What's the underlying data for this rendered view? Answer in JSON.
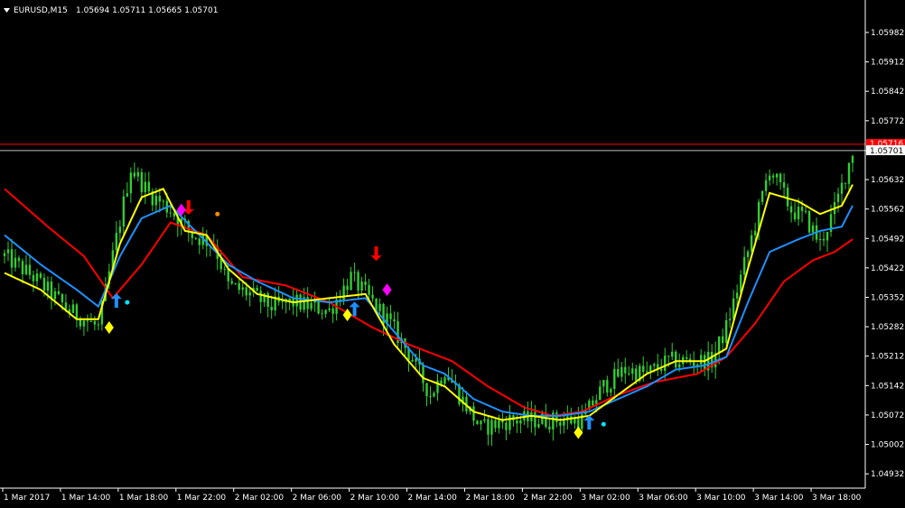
{
  "header": {
    "symbol": "EURUSD,M15",
    "ohlc": "1.05694 1.05711 1.05665 1.05701",
    "menu_icon": "triangle-down-icon"
  },
  "colors": {
    "background": "#000000",
    "axis": "#ffffff",
    "candles": "#32cd32",
    "ma_red": "#ff0000",
    "ma_yellow": "#ffff00",
    "ma_blue": "#1e90ff",
    "hline_red": "#ff0000",
    "hline_bid": "#c0c0c0",
    "marker_up": "#1e90ff",
    "marker_down": "#ff0000",
    "diamond_yellow": "#ffff00",
    "diamond_magenta": "#ff00ff",
    "dot_cyan": "#00e5ff",
    "dot_orange": "#ff8c00"
  },
  "chart_data": {
    "type": "candlestick",
    "title": "EURUSD,M15",
    "ylim": [
      1.04898,
      1.06012
    ],
    "y_ticks": [
      "1.05982",
      "1.05912",
      "1.05842",
      "1.05772",
      "1.05701",
      "1.05632",
      "1.05562",
      "1.05492",
      "1.05422",
      "1.05352",
      "1.05282",
      "1.05212",
      "1.05142",
      "1.05072",
      "1.05002",
      "1.04932"
    ],
    "current_price_label": "1.05701",
    "red_line_label": "1.05716",
    "red_line_price": 1.05716,
    "x_ticks": [
      "1 Mar 2017",
      "1 Mar 14:00",
      "1 Mar 18:00",
      "1 Mar 22:00",
      "2 Mar 02:00",
      "2 Mar 06:00",
      "2 Mar 10:00",
      "2 Mar 14:00",
      "2 Mar 18:00",
      "2 Mar 22:00",
      "3 Mar 02:00",
      "3 Mar 06:00",
      "3 Mar 10:00",
      "3 Mar 14:00",
      "3 Mar 18:00"
    ],
    "x_tick_index": [
      0,
      16,
      32,
      48,
      64,
      80,
      96,
      112,
      128,
      144,
      160,
      176,
      192,
      208,
      224
    ],
    "bar_count": 236,
    "close_anchors": [
      [
        0,
        1.0545
      ],
      [
        8,
        1.054
      ],
      [
        18,
        1.0532
      ],
      [
        26,
        1.0528
      ],
      [
        30,
        1.0545
      ],
      [
        35,
        1.0566
      ],
      [
        40,
        1.056
      ],
      [
        46,
        1.0556
      ],
      [
        52,
        1.055
      ],
      [
        58,
        1.0548
      ],
      [
        62,
        1.0538
      ],
      [
        68,
        1.0536
      ],
      [
        74,
        1.0533
      ],
      [
        80,
        1.0534
      ],
      [
        90,
        1.0532
      ],
      [
        96,
        1.054
      ],
      [
        100,
        1.0536
      ],
      [
        106,
        1.053
      ],
      [
        112,
        1.0522
      ],
      [
        118,
        1.0512
      ],
      [
        122,
        1.0518
      ],
      [
        126,
        1.0512
      ],
      [
        132,
        1.0504
      ],
      [
        140,
        1.0506
      ],
      [
        148,
        1.0506
      ],
      [
        156,
        1.0506
      ],
      [
        160,
        1.0506
      ],
      [
        166,
        1.0514
      ],
      [
        172,
        1.0518
      ],
      [
        178,
        1.0517
      ],
      [
        184,
        1.052
      ],
      [
        190,
        1.052
      ],
      [
        196,
        1.052
      ],
      [
        200,
        1.0528
      ],
      [
        206,
        1.0546
      ],
      [
        212,
        1.0566
      ],
      [
        218,
        1.0556
      ],
      [
        222,
        1.0554
      ],
      [
        226,
        1.0548
      ],
      [
        230,
        1.0556
      ],
      [
        235,
        1.057
      ]
    ],
    "ma_red_anchors": [
      [
        0,
        1.0561
      ],
      [
        12,
        1.0552
      ],
      [
        22,
        1.0545
      ],
      [
        30,
        1.0535
      ],
      [
        38,
        1.0543
      ],
      [
        46,
        1.0553
      ],
      [
        56,
        1.055
      ],
      [
        66,
        1.054
      ],
      [
        78,
        1.0538
      ],
      [
        90,
        1.0534
      ],
      [
        102,
        1.0528
      ],
      [
        112,
        1.0524
      ],
      [
        124,
        1.052
      ],
      [
        134,
        1.0514
      ],
      [
        144,
        1.0509
      ],
      [
        152,
        1.0507
      ],
      [
        160,
        1.0508
      ],
      [
        170,
        1.0512
      ],
      [
        180,
        1.0515
      ],
      [
        192,
        1.0517
      ],
      [
        200,
        1.0521
      ],
      [
        208,
        1.0529
      ],
      [
        216,
        1.0539
      ],
      [
        224,
        1.0544
      ],
      [
        230,
        1.0546
      ],
      [
        235,
        1.0549
      ]
    ],
    "ma_yellow_anchors": [
      [
        0,
        1.0541
      ],
      [
        10,
        1.0537
      ],
      [
        20,
        1.053
      ],
      [
        26,
        1.053
      ],
      [
        32,
        1.0548
      ],
      [
        38,
        1.0559
      ],
      [
        44,
        1.0561
      ],
      [
        50,
        1.0551
      ],
      [
        56,
        1.055
      ],
      [
        62,
        1.0542
      ],
      [
        70,
        1.0536
      ],
      [
        80,
        1.0534
      ],
      [
        90,
        1.0535
      ],
      [
        100,
        1.0536
      ],
      [
        108,
        1.0524
      ],
      [
        116,
        1.0516
      ],
      [
        122,
        1.0514
      ],
      [
        130,
        1.0508
      ],
      [
        138,
        1.0506
      ],
      [
        146,
        1.0507
      ],
      [
        154,
        1.0506
      ],
      [
        162,
        1.0507
      ],
      [
        170,
        1.0512
      ],
      [
        178,
        1.0517
      ],
      [
        186,
        1.052
      ],
      [
        194,
        1.052
      ],
      [
        200,
        1.0523
      ],
      [
        206,
        1.0542
      ],
      [
        212,
        1.056
      ],
      [
        220,
        1.0558
      ],
      [
        226,
        1.0555
      ],
      [
        232,
        1.0557
      ],
      [
        235,
        1.0562
      ]
    ],
    "ma_blue_anchors": [
      [
        0,
        1.055
      ],
      [
        10,
        1.0543
      ],
      [
        20,
        1.0537
      ],
      [
        26,
        1.0533
      ],
      [
        32,
        1.0545
      ],
      [
        38,
        1.0554
      ],
      [
        46,
        1.0557
      ],
      [
        54,
        1.055
      ],
      [
        62,
        1.0543
      ],
      [
        70,
        1.0539
      ],
      [
        80,
        1.0535
      ],
      [
        90,
        1.0534
      ],
      [
        100,
        1.0535
      ],
      [
        108,
        1.0527
      ],
      [
        116,
        1.0519
      ],
      [
        122,
        1.0517
      ],
      [
        130,
        1.0511
      ],
      [
        138,
        1.0508
      ],
      [
        146,
        1.0507
      ],
      [
        154,
        1.0507
      ],
      [
        162,
        1.0508
      ],
      [
        170,
        1.0511
      ],
      [
        178,
        1.0514
      ],
      [
        186,
        1.0518
      ],
      [
        194,
        1.0519
      ],
      [
        200,
        1.0521
      ],
      [
        206,
        1.0534
      ],
      [
        212,
        1.0546
      ],
      [
        220,
        1.0549
      ],
      [
        226,
        1.0551
      ],
      [
        232,
        1.0552
      ],
      [
        235,
        1.0557
      ]
    ],
    "arrows_up": [
      [
        31,
        1.0534
      ],
      [
        97,
        1.0532
      ],
      [
        162,
        1.0505
      ]
    ],
    "arrows_down": [
      [
        51,
        1.0557
      ],
      [
        103,
        1.0546
      ]
    ],
    "diamonds_yellow": [
      [
        29,
        1.0528
      ],
      [
        95,
        1.0531
      ],
      [
        159,
        1.0503
      ]
    ],
    "diamonds_magenta": [
      [
        49,
        1.0556
      ],
      [
        106,
        1.0537
      ]
    ],
    "dots_cyan": [
      [
        34,
        1.0534
      ],
      [
        166,
        1.0505
      ]
    ],
    "dots_orange": [
      [
        59,
        1.0555
      ]
    ]
  }
}
